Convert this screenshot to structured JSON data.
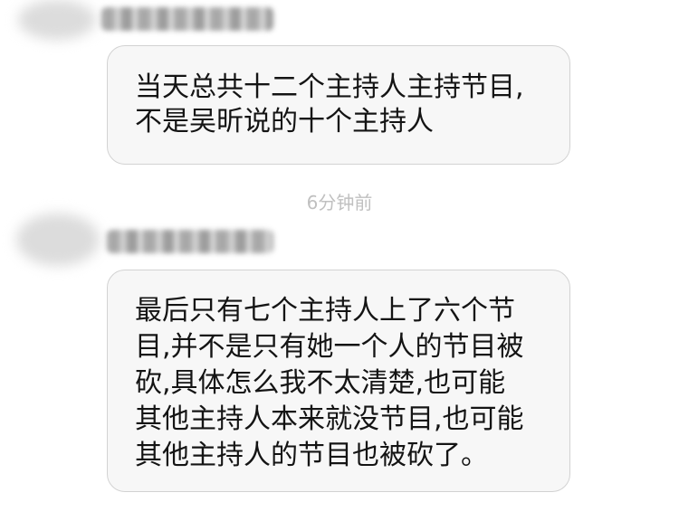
{
  "messages": [
    {
      "text_lines": [
        "当天总共十二个主持人主持节目,",
        "不是吴昕说的十个主持人"
      ]
    },
    {
      "text_lines": [
        "最后只有七个主持人上了六个节",
        "目,并不是只有她一个人的节目被",
        "砍,具体怎么我不太清楚,也可能",
        "其他主持人本来就没节目,也可能",
        "其他主持人的节目也被砍了。"
      ]
    }
  ],
  "timestamps": [
    "6分钟前"
  ],
  "icons": {
    "avatar": "blurred-avatar",
    "sender_name": "blurred-sender-name"
  }
}
